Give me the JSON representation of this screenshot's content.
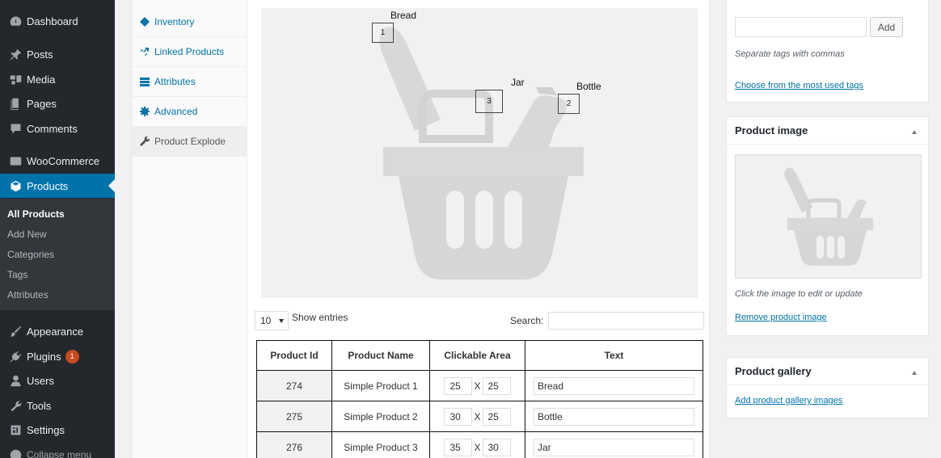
{
  "sidebar": {
    "items": [
      {
        "label": "Dashboard",
        "icon": "dashboard-icon"
      },
      {
        "label": "Posts",
        "icon": "pin-icon"
      },
      {
        "label": "Media",
        "icon": "media-icon"
      },
      {
        "label": "Pages",
        "icon": "page-icon"
      },
      {
        "label": "Comments",
        "icon": "comment-icon"
      },
      {
        "label": "WooCommerce",
        "icon": "woo-icon"
      },
      {
        "label": "Products",
        "icon": "box-icon"
      },
      {
        "label": "Appearance",
        "icon": "brush-icon"
      },
      {
        "label": "Plugins",
        "icon": "plug-icon",
        "badge": "1"
      },
      {
        "label": "Users",
        "icon": "user-icon"
      },
      {
        "label": "Tools",
        "icon": "wrench-icon"
      },
      {
        "label": "Settings",
        "icon": "settings-icon"
      },
      {
        "label": "Collapse menu",
        "icon": "collapse-icon"
      }
    ],
    "submenu": [
      "All Products",
      "Add New",
      "Categories",
      "Tags",
      "Attributes"
    ],
    "colors": {
      "bg": "#23282d",
      "active": "#0073aa",
      "submenu_bg": "#32373c"
    }
  },
  "product_tabs": [
    {
      "label": "Inventory",
      "icon": "inventory-icon"
    },
    {
      "label": "Linked Products",
      "icon": "link-icon"
    },
    {
      "label": "Attributes",
      "icon": "list-icon"
    },
    {
      "label": "Advanced",
      "icon": "gear-icon"
    },
    {
      "label": "Product Explode",
      "icon": "wrench-icon"
    }
  ],
  "explode": {
    "markers": [
      {
        "number": "1",
        "label": "Bread"
      },
      {
        "number": "2",
        "label": "Bottle"
      },
      {
        "number": "3",
        "label": "Jar"
      }
    ]
  },
  "table_controls": {
    "length_value": "10",
    "length_suffix": "Show entries",
    "search_label": "Search:",
    "search_value": ""
  },
  "table": {
    "headers": [
      "Product Id",
      "Product Name",
      "Clickable Area",
      "Text"
    ],
    "separator": "X",
    "rows": [
      {
        "id": "274",
        "name": "Simple Product 1",
        "w": "25",
        "h": "25",
        "text": "Bread"
      },
      {
        "id": "275",
        "name": "Simple Product 2",
        "w": "30",
        "h": "25",
        "text": "Bottle"
      },
      {
        "id": "276",
        "name": "Simple Product 3",
        "w": "35",
        "h": "30",
        "text": "Jar"
      }
    ]
  },
  "tags_box": {
    "input_value": "",
    "add_label": "Add",
    "hint": "Separate tags with commas",
    "link": "Choose from the most used tags"
  },
  "product_image_box": {
    "title": "Product image",
    "hint": "Click the image to edit or update",
    "remove_link": "Remove product image"
  },
  "gallery_box": {
    "title": "Product gallery",
    "add_link": "Add product gallery images"
  }
}
